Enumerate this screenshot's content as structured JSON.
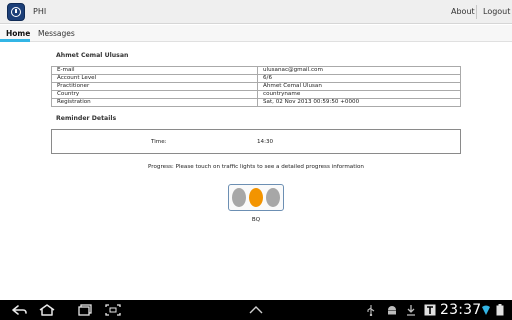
{
  "app": {
    "title": "PHI"
  },
  "actionbar": {
    "about_label": "About",
    "logout_label": "Logout"
  },
  "tabs": [
    {
      "label": "Home",
      "active": true
    },
    {
      "label": "Messages",
      "active": false
    }
  ],
  "profile": {
    "name": "Ahmet Cemal Ulusan",
    "rows": [
      {
        "key": "E-mail",
        "value": "ulusanac@gmail.com"
      },
      {
        "key": "Account Level",
        "value": "6/6"
      },
      {
        "key": "Practitioner",
        "value": "Ahmet Cemal Ulusan"
      },
      {
        "key": "Country",
        "value": "countryname"
      },
      {
        "key": "Registration",
        "value": "Sat, 02 Nov 2013 00:59:50 +0000"
      }
    ]
  },
  "reminder": {
    "title": "Reminder Details",
    "time_label": "Time:",
    "time_value": "14:30"
  },
  "progress": {
    "text": "Progress:  Please touch on traffic lights to see a detailed progress information",
    "lights": [
      "gray",
      "orange",
      "gray"
    ],
    "label": "BQ"
  },
  "colors": {
    "accent": "#33b5e5",
    "traffic_active": "#f39400",
    "traffic_inactive": "#a7a7a7"
  },
  "status_bar": {
    "time": "23:37"
  }
}
